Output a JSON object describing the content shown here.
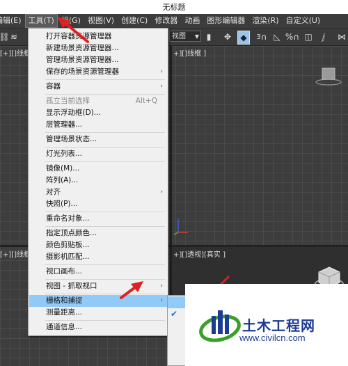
{
  "window": {
    "title": "无标题"
  },
  "menubar": {
    "items": [
      {
        "label": "编辑(E)"
      },
      {
        "label": "工具(T)"
      },
      {
        "label": "组(G)"
      },
      {
        "label": "视图(V)"
      },
      {
        "label": "创建(C)"
      },
      {
        "label": "修改器"
      },
      {
        "label": "动画"
      },
      {
        "label": "图形编辑器"
      },
      {
        "label": "渲染(R)"
      },
      {
        "label": "自定义(U)"
      }
    ]
  },
  "toolbar": {
    "view_dropdown": "视图",
    "snap_numbers": [
      "3",
      "%"
    ]
  },
  "viewports": {
    "top_left_label": "[+][]线框 ]",
    "top_right_label": "+][]线框 ]",
    "bottom_left_label": "[+][]线框 ]",
    "bottom_right_label": "+][]透视][真实 ]"
  },
  "tools_menu": {
    "items": [
      {
        "label": "打开容器资源管理器",
        "shortcut": "",
        "submenu": false,
        "disabled": false
      },
      {
        "label": "新建场景资源管理器...",
        "shortcut": "",
        "submenu": false,
        "disabled": false
      },
      {
        "label": "管理场景资源管理器...",
        "shortcut": "",
        "submenu": false,
        "disabled": false
      },
      {
        "label": "保存的场景资源管理器",
        "shortcut": "",
        "submenu": true,
        "disabled": false
      },
      {
        "label": "容器",
        "shortcut": "",
        "submenu": true,
        "disabled": false
      },
      {
        "label": "孤立当前选择",
        "shortcut": "Alt+Q",
        "submenu": false,
        "disabled": true
      },
      {
        "label": "显示浮动框(D)...",
        "shortcut": "",
        "submenu": false,
        "disabled": false
      },
      {
        "label": "层管理器...",
        "shortcut": "",
        "submenu": false,
        "disabled": false
      },
      {
        "label": "管理场景状态...",
        "shortcut": "",
        "submenu": false,
        "disabled": false
      },
      {
        "label": "灯光列表...",
        "shortcut": "",
        "submenu": false,
        "disabled": false
      },
      {
        "label": "镜像(M)...",
        "shortcut": "",
        "submenu": false,
        "disabled": false
      },
      {
        "label": "阵列(A)...",
        "shortcut": "",
        "submenu": false,
        "disabled": false
      },
      {
        "label": "对齐",
        "shortcut": "",
        "submenu": true,
        "disabled": false
      },
      {
        "label": "快照(P)...",
        "shortcut": "",
        "submenu": false,
        "disabled": false
      },
      {
        "label": "重命名对象...",
        "shortcut": "",
        "submenu": false,
        "disabled": false
      },
      {
        "label": "指定顶点颜色...",
        "shortcut": "",
        "submenu": false,
        "disabled": false
      },
      {
        "label": "颜色剪贴板...",
        "shortcut": "",
        "submenu": false,
        "disabled": false
      },
      {
        "label": "摄影机匹配...",
        "shortcut": "",
        "submenu": false,
        "disabled": false
      },
      {
        "label": "视口画布...",
        "shortcut": "",
        "submenu": false,
        "disabled": false
      },
      {
        "label": "视图 - 抓取视口",
        "shortcut": "",
        "submenu": true,
        "disabled": false
      },
      {
        "label": "栅格和捕捉",
        "shortcut": "",
        "submenu": true,
        "disabled": false,
        "highlighted": true
      },
      {
        "label": "测量距离...",
        "shortcut": "",
        "submenu": false,
        "disabled": false
      },
      {
        "label": "通道信息...",
        "shortcut": "",
        "submenu": false,
        "disabled": false
      }
    ]
  },
  "watermark": {
    "brand": "土木工程网",
    "url": "www.civilcn.com"
  },
  "colors": {
    "menu_bg": "#f0f0f0",
    "menu_highlight": "#91c9f7",
    "viewport_bg": "#3d3d3d",
    "arrow": "#e02020",
    "brand_blue": "#1c3b95",
    "brand_green": "#3aa02a"
  }
}
